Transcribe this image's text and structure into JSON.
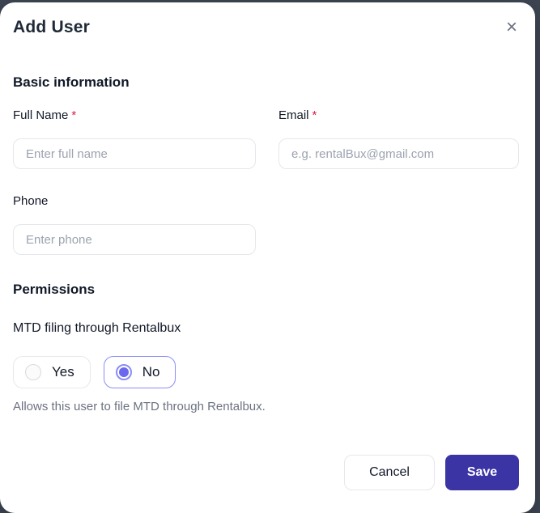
{
  "modal": {
    "title": "Add User",
    "close_icon": "×"
  },
  "basic_info": {
    "heading": "Basic information",
    "full_name": {
      "label": "Full Name",
      "required_mark": "*",
      "placeholder": "Enter full name",
      "value": ""
    },
    "email": {
      "label": "Email",
      "required_mark": "*",
      "placeholder": "e.g. rentalBux@gmail.com",
      "value": ""
    },
    "phone": {
      "label": "Phone",
      "placeholder": "Enter phone",
      "value": ""
    }
  },
  "permissions": {
    "heading": "Permissions",
    "mtd_filing": {
      "label": "MTD filing through Rentalbux",
      "options": [
        {
          "label": "Yes",
          "selected": false
        },
        {
          "label": "No",
          "selected": true
        }
      ],
      "help_text": "Allows this user to file MTD through Rentalbux."
    }
  },
  "footer": {
    "cancel_label": "Cancel",
    "save_label": "Save"
  },
  "colors": {
    "backdrop": "#3e4553",
    "save_button": "#3b34a5",
    "radio_selected": "#6b68ee",
    "radio_selected_border": "#8a8ef7",
    "required_mark": "#e11d48"
  }
}
